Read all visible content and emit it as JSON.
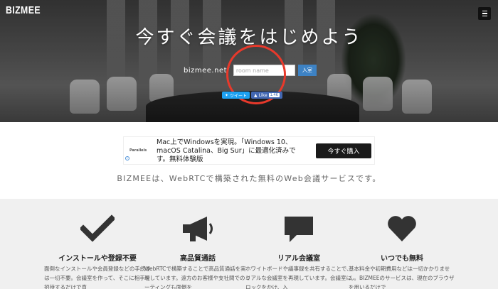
{
  "header": {
    "logo": "BIZMEE",
    "menu_icon": "hamburger-icon"
  },
  "hero": {
    "title": "今すぐ会議をはじめよう",
    "room_prefix": "bizmee.net/",
    "room_placeholder": "room name",
    "room_value": "",
    "submit_label": "入室",
    "tweet_label": "ツイート",
    "like_label": "Like",
    "like_count": "1.4K"
  },
  "ad": {
    "brand": "Parallels",
    "text": "Mac上でWindowsを実現。「Windows 10、macOS Catalina、Big Sur」に最適化済みです。無料体験版",
    "cta": "今すぐ購入"
  },
  "tagline": "BIZMEEは、WebRTCで構築された無料のWeb会議サービスです。",
  "features": [
    {
      "icon": "checkmark-icon",
      "title": "インストールや登録不要",
      "desc": "面倒なインストールや会員登録などの手続きは一切不要。会議室を作って、そこに相手を招待するだけで直"
    },
    {
      "icon": "megaphone-icon",
      "title": "高品質通話",
      "desc": "WebRTCで構築することで高品質通話を実現しています。遠方のお客様や支社間でのミーティングも面倒を"
    },
    {
      "icon": "speech-bubble-icon",
      "title": "リアル会議室",
      "desc": "ホワイトボードや議事録を共有することで、リアルな会議室を再現しています。会議室にロックをかけ、入"
    },
    {
      "icon": "heart-icon",
      "title": "いつでも無料",
      "desc": "基本料金や初期費用などは一切かかりません。BIZMEEのサービスは、現在のブラウザを用いるだけで"
    }
  ],
  "colors": {
    "accent_blue": "#3d82c4",
    "highlight_red": "#e8392b",
    "twitter": "#1da1f2",
    "facebook": "#4267b2"
  }
}
